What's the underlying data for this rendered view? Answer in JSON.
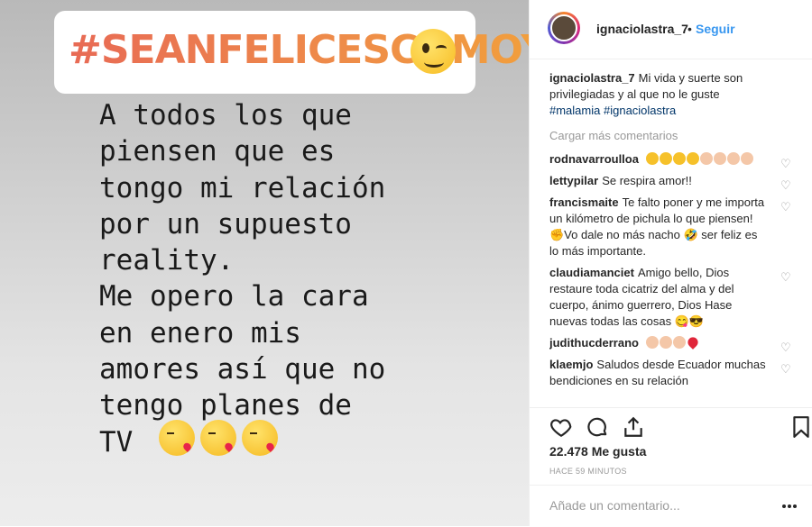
{
  "story": {
    "hashtag": "#SEANFELICESCOMOYO",
    "text": "A todos los que\npiensen que es\ntongo mi relación\npor un supuesto\nreality.\nMe opero la cara\nen enero mis\namores así que no\ntengo planes de\nTV"
  },
  "post": {
    "username": "ignaciolastra_7",
    "dot": "•",
    "follow_label": "Seguir",
    "caption_user": "ignaciolastra_7",
    "caption_text": "Mi vida y suerte son privilegiadas y al que no le guste",
    "caption_tags": [
      "#malamia",
      "#ignaciolastra"
    ],
    "load_more": "Cargar más comentarios",
    "comments": [
      {
        "user": "rodnavarroulloa",
        "text": ""
      },
      {
        "user": "lettypilar",
        "text": "Se respira amor!!"
      },
      {
        "user": "francismaite",
        "text": "Te falto poner y me importa un kilómetro de pichula lo que piensen! ✊Vo dale no más nacho 🤣 ser feliz es lo más importante."
      },
      {
        "user": "claudiamanciet",
        "text": "Amigo bello, Dios restaure toda cicatriz del alma y del cuerpo, ánimo guerrero, Dios Hase nuevas todas las cosas 😋😎"
      },
      {
        "user": "judithucderrano",
        "text": ""
      },
      {
        "user": "klaemjo",
        "text": "Saludos desde Ecuador muchas bendiciones en su relación"
      }
    ],
    "likes": "22.478 Me gusta",
    "time": "HACE 59 MINUTOS",
    "add_placeholder": "Añade un comentario..."
  },
  "colors": {
    "link": "#3897f0",
    "hashtag": "#003569",
    "muted": "#999999"
  }
}
